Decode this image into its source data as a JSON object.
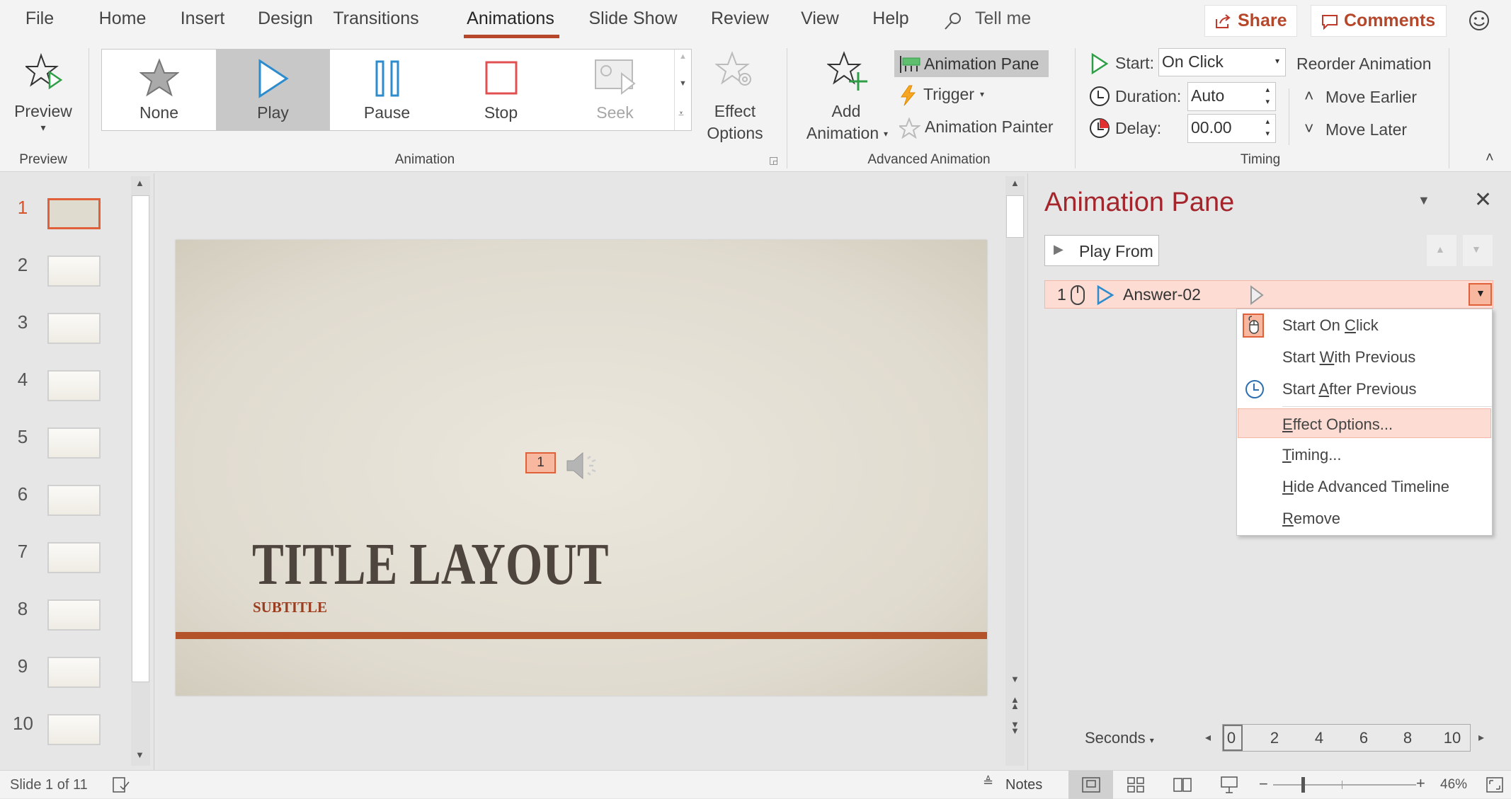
{
  "tabs": [
    "File",
    "Home",
    "Insert",
    "Design",
    "Transitions",
    "Animations",
    "Slide Show",
    "Review",
    "View",
    "Help"
  ],
  "active_tab": "Animations",
  "tell_me": "Tell me",
  "share": "Share",
  "comments": "Comments",
  "accent": "#b7472a",
  "ribbon": {
    "preview": {
      "label": "Preview",
      "group": "Preview"
    },
    "animation": {
      "items": [
        {
          "label": "None"
        },
        {
          "label": "Play"
        },
        {
          "label": "Pause"
        },
        {
          "label": "Stop"
        },
        {
          "label": "Seek"
        }
      ],
      "selected": "Play",
      "effect_options": [
        "Effect",
        "Options"
      ],
      "group": "Animation"
    },
    "advanced": {
      "add": [
        "Add",
        "Animation"
      ],
      "animation_pane": "Animation Pane",
      "trigger": "Trigger",
      "painter": "Animation Painter",
      "group": "Advanced Animation"
    },
    "timing": {
      "start_label": "Start:",
      "start_value": "On Click",
      "duration_label": "Duration:",
      "duration_value": "Auto",
      "delay_label": "Delay:",
      "delay_value": "00.00",
      "reorder": "Reorder Animation",
      "move_earlier": "Move Earlier",
      "move_later": "Move Later",
      "group": "Timing"
    }
  },
  "thumbnails": [
    "1",
    "2",
    "3",
    "4",
    "5",
    "6",
    "7",
    "8",
    "9",
    "10"
  ],
  "selected_slide": "1",
  "slide": {
    "title": "TITLE LAYOUT",
    "subtitle": "SUBTITLE",
    "anim_tag": "1"
  },
  "pane": {
    "title": "Animation Pane",
    "play_from": "Play From",
    "item": {
      "number": "1",
      "name": "Answer-02"
    },
    "menu": [
      {
        "pre": "Start On ",
        "key": "C",
        "post": "lick"
      },
      {
        "pre": "Start ",
        "key": "W",
        "post": "ith Previous"
      },
      {
        "pre": "Start ",
        "key": "A",
        "post": "fter Previous"
      },
      {
        "pre": "",
        "key": "E",
        "post": "ffect Options..."
      },
      {
        "pre": "",
        "key": "T",
        "post": "iming..."
      },
      {
        "pre": "",
        "key": "H",
        "post": "ide Advanced Timeline"
      },
      {
        "pre": "",
        "key": "R",
        "post": "emove"
      }
    ],
    "highlighted": "Effect Options...",
    "seconds": "Seconds",
    "ticks": [
      "0",
      "2",
      "4",
      "6",
      "8",
      "10"
    ]
  },
  "status": {
    "slide_info": "Slide 1 of 11",
    "notes": "Notes",
    "zoom": "46%"
  }
}
